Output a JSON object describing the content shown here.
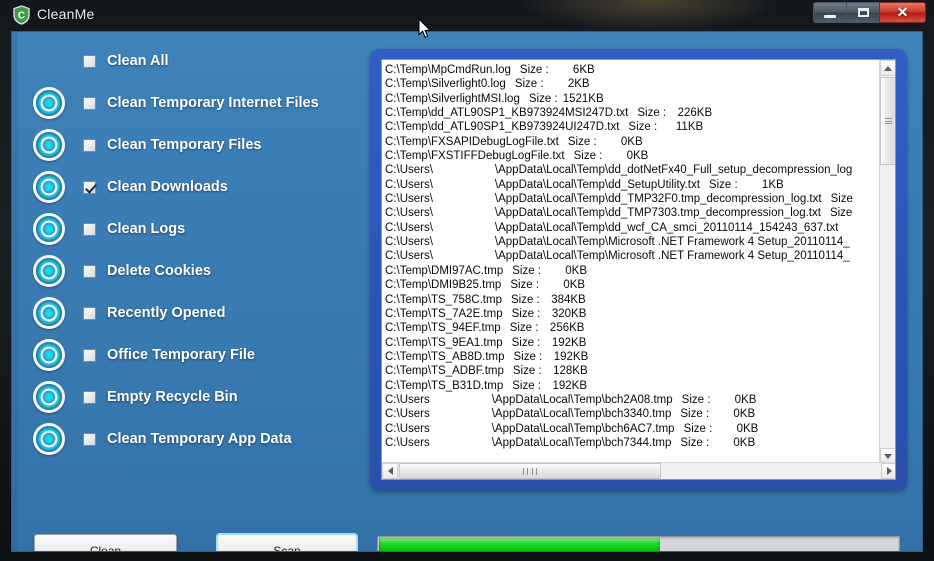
{
  "window": {
    "title": "CleanMe",
    "icon": "shield-c-icon",
    "controls": {
      "minimize": "–",
      "maximize": "□",
      "close": "✕"
    }
  },
  "sidebar": {
    "options": [
      {
        "label": "Clean All",
        "checked": false,
        "has_radio": false
      },
      {
        "label": "Clean Temporary Internet Files",
        "checked": false,
        "has_radio": true
      },
      {
        "label": "Clean Temporary Files",
        "checked": false,
        "has_radio": true
      },
      {
        "label": "Clean Downloads",
        "checked": true,
        "has_radio": true
      },
      {
        "label": "Clean Logs",
        "checked": false,
        "has_radio": true
      },
      {
        "label": "Delete Cookies",
        "checked": false,
        "has_radio": true
      },
      {
        "label": "Recently Opened",
        "checked": false,
        "has_radio": true
      },
      {
        "label": "Office Temporary File",
        "checked": false,
        "has_radio": true
      },
      {
        "label": "Empty Recycle Bin",
        "checked": false,
        "has_radio": true
      },
      {
        "label": "Clean Temporary App Data",
        "checked": false,
        "has_radio": true
      }
    ]
  },
  "file_list": {
    "size_label": "Size :",
    "rows": [
      {
        "path": "C:\\Temp\\MpCmdRun.log",
        "size": "6KB"
      },
      {
        "path": "C:\\Temp\\Silverlight0.log",
        "size": "2KB"
      },
      {
        "path": "C:\\Temp\\SilverlightMSI.log",
        "size": "1521KB"
      },
      {
        "path": "C:\\Temp\\dd_ATL90SP1_KB973924MSI247D.txt",
        "size": "226KB"
      },
      {
        "path": "C:\\Temp\\dd_ATL90SP1_KB973924UI247D.txt",
        "size": "11KB"
      },
      {
        "path": "C:\\Temp\\FXSAPIDebugLogFile.txt",
        "size": "0KB"
      },
      {
        "path": "C:\\Temp\\FXSTIFFDebugLogFile.txt",
        "size": "0KB"
      },
      {
        "prefix": "C:\\Users\\",
        "redacted": true,
        "path": "\\AppData\\Local\\Temp\\dd_dotNetFx40_Full_setup_decompression_log",
        "size": ""
      },
      {
        "prefix": "C:\\Users\\",
        "redacted": true,
        "path": "\\AppData\\Local\\Temp\\dd_SetupUtility.txt",
        "size": "1KB"
      },
      {
        "prefix": "C:\\Users\\",
        "redacted": true,
        "path": "\\AppData\\Local\\Temp\\dd_TMP32F0.tmp_decompression_log.txt",
        "size_label_only": "Size"
      },
      {
        "prefix": "C:\\Users\\",
        "redacted": true,
        "path": "\\AppData\\Local\\Temp\\dd_TMP7303.tmp_decompression_log.txt",
        "size_label_only": "Size"
      },
      {
        "prefix": "C:\\Users\\",
        "redacted": true,
        "path": "\\AppData\\Local\\Temp\\dd_wcf_CA_smci_20110114_154243_637.txt",
        "size": ""
      },
      {
        "prefix": "C:\\Users\\",
        "redacted": true,
        "path": "\\AppData\\Local\\Temp\\Microsoft .NET Framework 4 Setup_20110114_",
        "size": ""
      },
      {
        "prefix": "C:\\Users\\",
        "redacted": true,
        "path": "\\AppData\\Local\\Temp\\Microsoft .NET Framework 4 Setup_20110114_",
        "size": ""
      },
      {
        "path": "C:\\Temp\\DMI97AC.tmp",
        "size": "0KB"
      },
      {
        "path": "C:\\Temp\\DMI9B25.tmp",
        "size": "0KB"
      },
      {
        "path": "C:\\Temp\\TS_758C.tmp",
        "size": "384KB"
      },
      {
        "path": "C:\\Temp\\TS_7A2E.tmp",
        "size": "320KB"
      },
      {
        "path": "C:\\Temp\\TS_94EF.tmp",
        "size": "256KB"
      },
      {
        "path": "C:\\Temp\\TS_9EA1.tmp",
        "size": "192KB"
      },
      {
        "path": "C:\\Temp\\TS_AB8D.tmp",
        "size": "192KB"
      },
      {
        "path": "C:\\Temp\\TS_ADBF.tmp",
        "size": "128KB"
      },
      {
        "path": "C:\\Temp\\TS_B31D.tmp",
        "size": "192KB"
      },
      {
        "prefix": "C:\\Users",
        "redacted": true,
        "path": "\\AppData\\Local\\Temp\\bch2A08.tmp",
        "size": "0KB"
      },
      {
        "prefix": "C:\\Users",
        "redacted": true,
        "path": "\\AppData\\Local\\Temp\\bch3340.tmp",
        "size": "0KB"
      },
      {
        "prefix": "C:\\Users",
        "redacted": true,
        "path": "\\AppData\\Local\\Temp\\bch6AC7.tmp",
        "size": "0KB"
      },
      {
        "prefix": "C:\\Users",
        "redacted": true,
        "path": "\\AppData\\Local\\Temp\\bch7344.tmp",
        "size": "0KB"
      }
    ]
  },
  "footer": {
    "clean_button": "Clean",
    "scan_button": "Scan",
    "progress_percent": 54
  },
  "colors": {
    "background_blue": "#3a7cb4",
    "panel_blue": "#2b56b6",
    "progress_green": "#05c506",
    "accent_cyan": "#16e0f0",
    "close_red": "#cf3a2c"
  }
}
